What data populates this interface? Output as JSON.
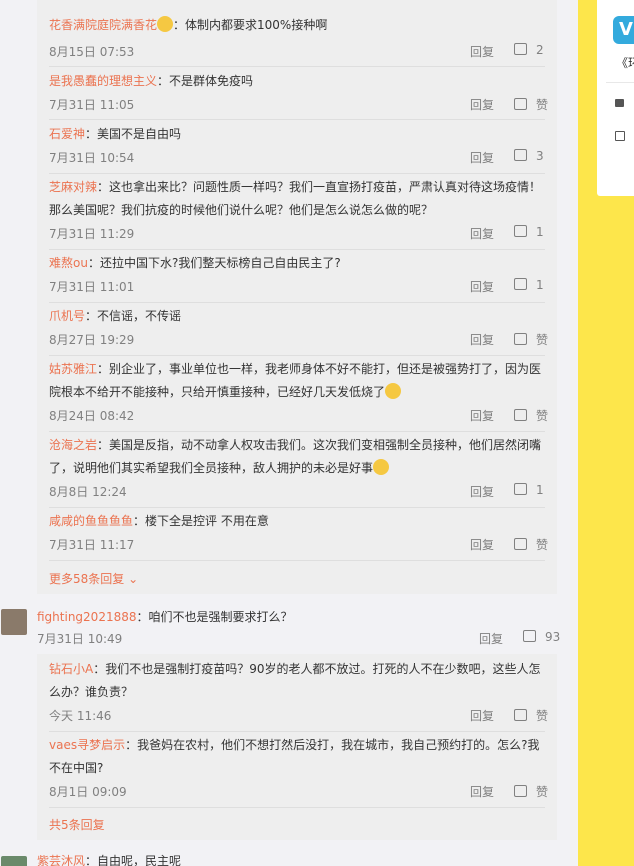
{
  "sidebar": {
    "logo_text": "V",
    "text": "《环"
  },
  "replies_group1": [
    {
      "user": "花香满院庭院满香花",
      "text": "：体制内都要求100%接种啊",
      "time": "8月15日 07:53",
      "reply": "回复",
      "likes": "2"
    },
    {
      "user": "是我愚蠢的理想主义",
      "text": "：不是群体免疫吗",
      "time": "7月31日 11:05",
      "reply": "回复",
      "likes": "赞"
    },
    {
      "user": "石爱神",
      "text": "：美国不是自由吗",
      "time": "7月31日 10:54",
      "reply": "回复",
      "likes": "3"
    },
    {
      "user": "芝麻对辣",
      "text": "：这也拿出来比？问题性质一样吗？我们一直宣扬打疫苗，严肃认真对待这场疫情！",
      "text2": "那么美国呢？我们抗疫的时候他们说什么呢？他们是怎么说怎么做的呢？",
      "time": "7月31日 11:29",
      "reply": "回复",
      "likes": "1"
    },
    {
      "user": "难熬ou",
      "text": "：还拉中国下水?我们整天标榜自己自由民主了?",
      "time": "7月31日 11:01",
      "reply": "回复",
      "likes": "1"
    },
    {
      "user": "爪机号",
      "text": "：不信谣，不传谣",
      "time": "8月27日 19:29",
      "reply": "回复",
      "likes": "赞"
    },
    {
      "user": "姑苏雅江",
      "text": "：别企业了，事业单位也一样，我老师身体不好不能打，但还是被强势打了，因为医",
      "text2": "院根本不给开不能接种，只给开慎重接种，已经好几天发低烧了",
      "time": "8月24日 08:42",
      "reply": "回复",
      "likes": "赞"
    },
    {
      "user": "沧海之岩",
      "text": "：美国是反指，动不动拿人权攻击我们。这次我们变相强制全员接种，他们居然闭嘴",
      "text2": "了，说明他们其实希望我们全员接种，敌人拥护的未必是好事",
      "time": "8月8日 12:24",
      "reply": "回复",
      "likes": "1"
    },
    {
      "user": "咸咸的鱼鱼鱼鱼",
      "text": "：楼下全是控评 不用在意",
      "time": "7月31日 11:17",
      "reply": "回复",
      "likes": "赞"
    }
  ],
  "more_replies_1": "更多58条回复 ⌄",
  "main_comment": {
    "user": "fighting2021888",
    "text": "：咱们不也是强制要求打么？",
    "time": "7月31日 10:49",
    "reply": "回复",
    "likes": "93"
  },
  "replies_group2": [
    {
      "user": "钻石小A",
      "text": "：我们不也是强制打疫苗吗？90岁的老人都不放过。打死的人不在少数吧，这些人怎",
      "text2": "么办？谁负责？",
      "time": "今天 11:46",
      "reply": "回复",
      "likes": "赞"
    },
    {
      "user": "vaes寻梦启示",
      "text": "：我爸妈在农村，他们不想打然后没打，我在城市，我自己预约打的。怎么?我",
      "text2": "不在中国?",
      "time": "8月1日 09:09",
      "reply": "回复",
      "likes": "赞"
    }
  ],
  "more_replies_2": "共5条回复",
  "last_comment": {
    "user": "紫芸沐风",
    "text": "：自由呢，民主呢"
  }
}
